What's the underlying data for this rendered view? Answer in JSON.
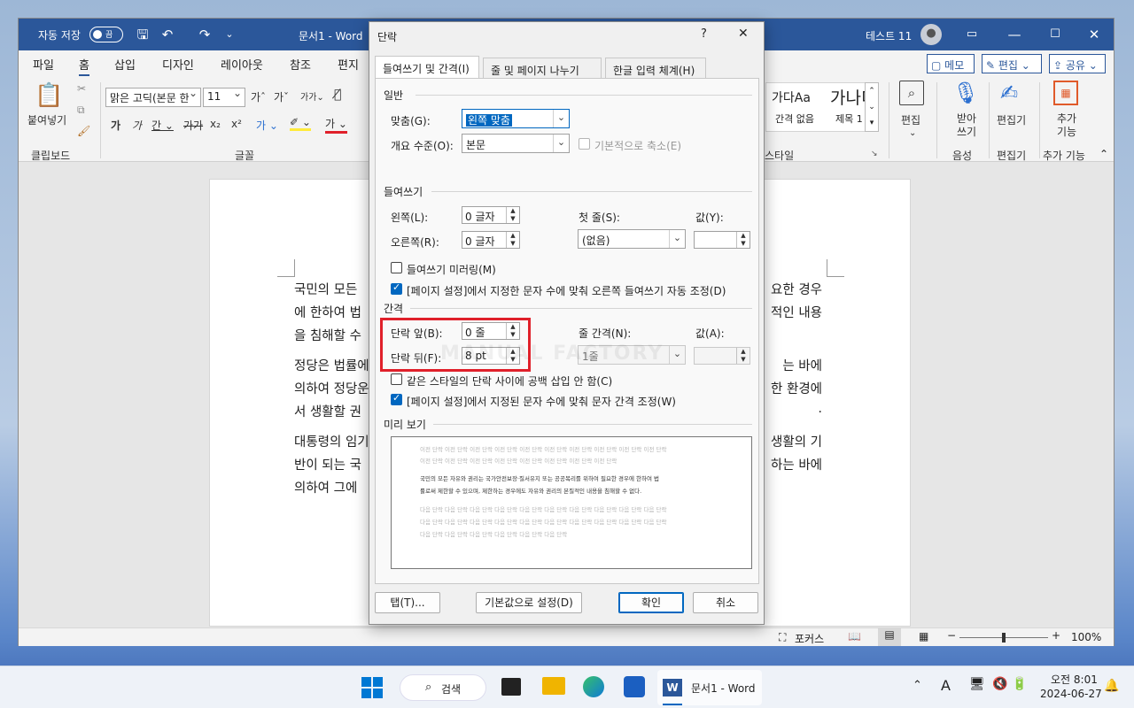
{
  "word": {
    "autosave_label": "자동 저장",
    "autosave_state": "끔",
    "doc_title": "문서1 - Word",
    "user_name": "테스트 11",
    "menus": [
      "파일",
      "홈",
      "삽입",
      "디자인",
      "레이아웃",
      "참조",
      "편지"
    ],
    "active_menu": "홈",
    "right_buttons": {
      "memo": "메모",
      "edit": "편집",
      "share": "공유"
    },
    "ribbon": {
      "paste_label": "붙여넣기",
      "clipboard_group": "클립보드",
      "font_group": "글꼴",
      "font_name": "맑은 고딕(본문 한",
      "font_size": "11",
      "style_sample1": "가다Aa",
      "style_sample1_name": "간격 없음",
      "style_sample2": "가나디",
      "style_sample2_name": "제목 1",
      "style_group": "스타일",
      "find_label": "편집",
      "dictate_label": "받아 쓰기",
      "voice_group": "음성",
      "editor_label": "편집기",
      "editor_group": "편집기",
      "addins_label": "추가 기능",
      "addins_group": "추가 기능"
    },
    "paragraphs": [
      [
        "국민의 모든",
        "요한 경우"
      ],
      [
        "에 한하여 법",
        "적인 내용"
      ],
      [
        "을 침해할 수",
        ""
      ],
      [
        "정당은 법률에",
        "는 바에"
      ],
      [
        "의하여 정당운",
        "한 환경에"
      ],
      [
        "서 생활할 권",
        "."
      ],
      [
        "대통령의 임기",
        "생활의 기"
      ],
      [
        "반이 되는 국",
        "하는 바에"
      ],
      [
        "의하여 그에",
        ""
      ]
    ],
    "statusbar": {
      "focus": "포커스",
      "zoom": "100%"
    }
  },
  "dialog": {
    "title": "단락",
    "help": "?",
    "close": "✕",
    "tabs": [
      "들여쓰기 및 간격(I)",
      "줄 및 페이지 나누기(P)",
      "한글 입력 체계(H)"
    ],
    "general": {
      "section": "일반",
      "align_label": "맞춤(G):",
      "align_value": "왼쪽 맞춤",
      "outline_label": "개요 수준(O):",
      "outline_value": "본문",
      "collapsed_label": "기본적으로 축소(E)"
    },
    "indent": {
      "section": "들여쓰기",
      "left_label": "왼쪽(L):",
      "left_value": "0 글자",
      "right_label": "오른쪽(R):",
      "right_value": "0 글자",
      "first_label": "첫 줄(S):",
      "first_value": "(없음)",
      "by_label": "값(Y):",
      "by_value": "",
      "mirror_label": "들여쓰기 미러링(M)",
      "auto_label": "[페이지 설정]에서 지정한 문자 수에 맞춰 오른쪽 들여쓰기 자동 조정(D)"
    },
    "spacing": {
      "section": "간격",
      "before_label": "단락 앞(B):",
      "before_value": "0 줄",
      "after_label": "단락 뒤(F):",
      "after_value": "8 pt",
      "line_label": "줄 간격(N):",
      "line_value": "1줄",
      "at_label": "값(A):",
      "at_value": "",
      "same_style_label": "같은 스타일의 단락 사이에 공백 삽입 안 함(C)",
      "grid_label": "[페이지 설정]에서 지정된 문자 수에 맞춰 문자 간격 조정(W)"
    },
    "preview": {
      "section": "미리 보기",
      "prev_lines": [
        "이전 단락 이전 단락 이전 단락 이전 단락 이전 단락 이전 단락 이전 단락 이전 단락 이전 단락 이전 단락",
        "이전 단락 이전 단락 이전 단락 이전 단락 이전 단락 이전 단락 이전 단락 이전 단락"
      ],
      "cur_lines": [
        "국민의 모든 자유와 권리는 국가안전보장·질서유지 또는 공공복리를 위하여 필요한 경우에 한하여 법",
        "률로써 제한할 수 있으며, 제한하는 경우에도 자유와 권리의 본질적인 내용을 침해할 수 없다."
      ],
      "next_lines": [
        "다음 단락 다음 단락 다음 단락 다음 단락 다음 단락 다음 단락 다음 단락 다음 단락 다음 단락 다음 단락",
        "다음 단락 다음 단락 다음 단락 다음 단락 다음 단락 다음 단락 다음 단락 다음 단락 다음 단락 다음 단락",
        "다음 단락 다음 단락 다음 단락 다음 단락 다음 단락 다음 단락"
      ]
    },
    "watermark": "MANUAL FACTORY",
    "buttons": {
      "tabs": "탭(T)...",
      "default": "기본값으로 설정(D)",
      "ok": "확인",
      "cancel": "취소"
    }
  },
  "taskbar": {
    "search": "검색",
    "word_app": "문서1 - Word",
    "time": "오전 8:01",
    "date": "2024-06-27"
  },
  "colors": {
    "word_blue": "#2b579a",
    "highlight_red": "#e0202a",
    "accent": "#0067c0"
  }
}
